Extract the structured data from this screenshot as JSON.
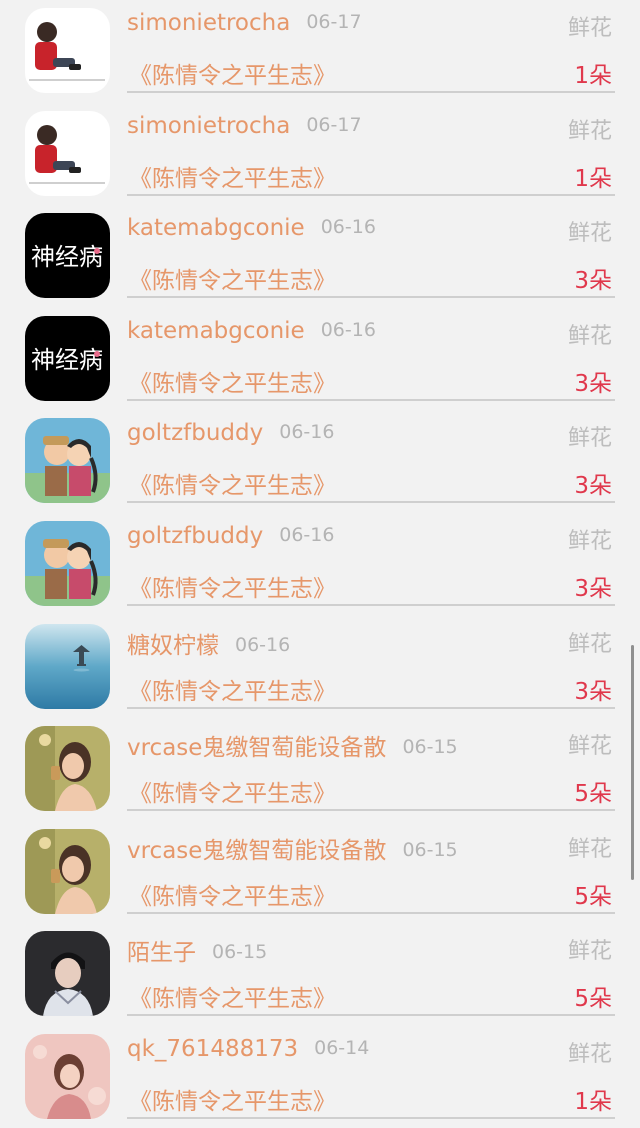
{
  "rows": [
    {
      "name": "simonietrocha",
      "date": "06-17",
      "gift": "鲜花",
      "book": "《陈情令之平生志》",
      "count": "1朵",
      "avatar": "boy-red-jacket-icon"
    },
    {
      "name": "simonietrocha",
      "date": "06-17",
      "gift": "鲜花",
      "book": "《陈情令之平生志》",
      "count": "1朵",
      "avatar": "boy-red-jacket-icon"
    },
    {
      "name": "katemabgconie",
      "date": "06-16",
      "gift": "鲜花",
      "book": "《陈情令之平生志》",
      "count": "3朵",
      "avatar": "black-calligraphy-icon",
      "avatar_text": "神经病"
    },
    {
      "name": "katemabgconie",
      "date": "06-16",
      "gift": "鲜花",
      "book": "《陈情令之平生志》",
      "count": "3朵",
      "avatar": "black-calligraphy-icon",
      "avatar_text": "神经病"
    },
    {
      "name": "goltzfbuddy",
      "date": "06-16",
      "gift": "鲜花",
      "book": "《陈情令之平生志》",
      "count": "3朵",
      "avatar": "anime-couple-icon"
    },
    {
      "name": "goltzfbuddy",
      "date": "06-16",
      "gift": "鲜花",
      "book": "《陈情令之平生志》",
      "count": "3朵",
      "avatar": "anime-couple-icon"
    },
    {
      "name": "糖奴柠檬",
      "date": "06-16",
      "gift": "鲜花",
      "book": "《陈情令之平生志》",
      "count": "3朵",
      "avatar": "lake-pavilion-icon"
    },
    {
      "name": "vrcase鬼缴智萄能设备散",
      "date": "06-15",
      "gift": "鲜花",
      "book": "《陈情令之平生志》",
      "count": "5朵",
      "avatar": "woman-portrait-icon"
    },
    {
      "name": "vrcase鬼缴智萄能设备散",
      "date": "06-15",
      "gift": "鲜花",
      "book": "《陈情令之平生志》",
      "count": "5朵",
      "avatar": "woman-portrait-icon"
    },
    {
      "name": "陌生子",
      "date": "06-15",
      "gift": "鲜花",
      "book": "《陈情令之平生志》",
      "count": "5朵",
      "avatar": "young-man-portrait-icon"
    },
    {
      "name": "qk_761488173",
      "date": "06-14",
      "gift": "鲜花",
      "book": "《陈情令之平生志》",
      "count": "1朵",
      "avatar": "girl-pink-portrait-icon"
    }
  ]
}
